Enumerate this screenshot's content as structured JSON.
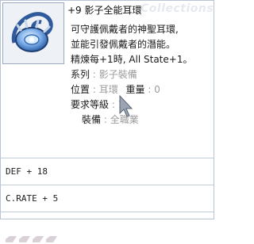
{
  "item": {
    "title": "+9 影子全能耳環",
    "watermark": "Collections",
    "description": [
      "可守護佩戴者的神聖耳環,",
      "並能引發佩戴者的潛能。"
    ],
    "effect": "精煉每+1時, All State+1。",
    "series_label": "系列",
    "series_value": ": 影子裝備",
    "position_label": "位置",
    "position_value": ": 耳環",
    "weight_label": "重量",
    "weight_value": ": 0",
    "level_label": "要求等級",
    "level_value": ": 1",
    "equip_label": "裝備",
    "equip_value": ": 全職業"
  },
  "panels": {
    "def": "DEF + 18",
    "crate": "C.RATE + 5"
  },
  "icons": {
    "item_icon": "shadow-earring-icon",
    "cursor": "mouse-cursor-icon",
    "slot": "empty-slot-icon"
  },
  "colors": {
    "border": "#b8c4d6",
    "label": "#1a1a1a",
    "dim": "#9b9b9b"
  }
}
